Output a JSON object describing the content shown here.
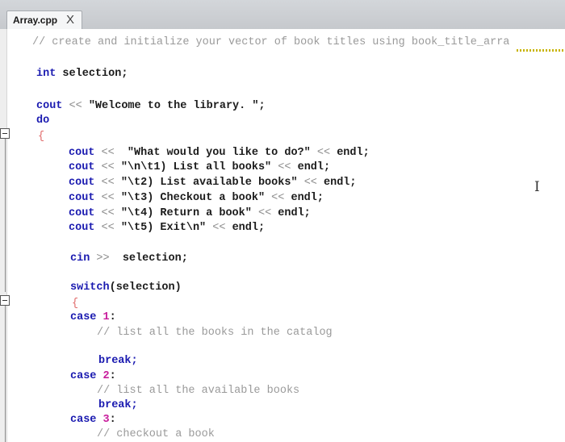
{
  "tab": {
    "title": "Array.cpp",
    "close": "X"
  },
  "code": {
    "comment_vector": "// create and initialize your vector of book titles using book_title_arra",
    "decl_type": "int",
    "decl_name": " selection;",
    "cout_welcome_kw": "cout",
    "op_shift": "<<",
    "welcome_str": "\"Welcome to the library. \";",
    "do_kw": "do",
    "open_brace": "{",
    "menu": [
      {
        "kw": "cout",
        "op": "<<",
        "str": "  \"What would you like to do?\"",
        "op2": "<<",
        "end": "endl;"
      },
      {
        "kw": "cout",
        "op": "<<",
        "str": "\"\\n\\t1) List all books\"",
        "op2": "<<",
        "end": "endl;"
      },
      {
        "kw": "cout",
        "op": "<<",
        "str": "\"\\t2) List available books\"",
        "op2": "<<",
        "end": "endl;"
      },
      {
        "kw": "cout",
        "op": "<<",
        "str": "\"\\t3) Checkout a book\"",
        "op2": "<<",
        "end": "endl;"
      },
      {
        "kw": "cout",
        "op": "<<",
        "str": "\"\\t4) Return a book\"",
        "op2": "<<",
        "end": "endl;"
      },
      {
        "kw": "cout",
        "op": "<<",
        "str": "\"\\t5) Exit\\n\"",
        "op2": "<<",
        "end": "endl;"
      }
    ],
    "cin_kw": "cin",
    "cin_op": ">>",
    "cin_var": "selection;",
    "switch_kw": "switch",
    "switch_expr": "(selection)",
    "switch_brace": "{",
    "case1_kw": "case",
    "case1_num": "1",
    "case1_colon": ":",
    "case1_comment": "// list all the books in the catalog",
    "break1": "break;",
    "case2_kw": "case",
    "case2_num": "2",
    "case2_colon": ":",
    "case2_comment": "// list all the available books",
    "break2": "break;",
    "case3_kw": "case",
    "case3_num": "3",
    "case3_colon": ":",
    "case3_comment": "// checkout a book"
  },
  "colors": {
    "keyword": "#1a1ab0",
    "number": "#c81c9c",
    "comment": "#9a9a9a",
    "brace": "#e06a6a"
  },
  "icons": {
    "text_cursor": "I-beam-cursor-icon"
  },
  "cursor_glyph": "I"
}
